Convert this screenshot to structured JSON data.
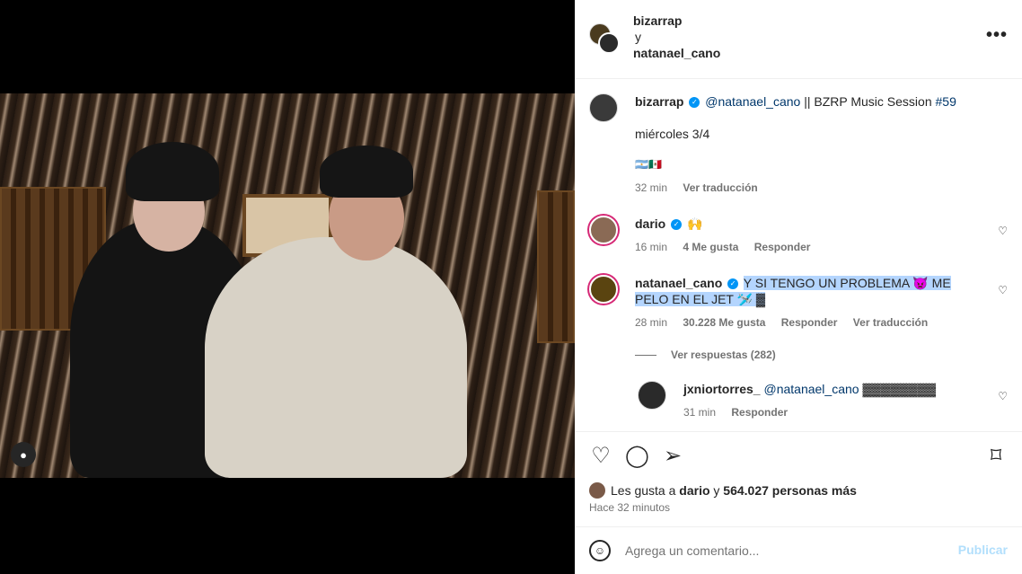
{
  "header": {
    "user1": "bizarrap",
    "joiner": "y",
    "user2": "natanael_cano",
    "more": "•••"
  },
  "caption": {
    "username": "bizarrap",
    "mention": "@natanael_cano",
    "text": " || BZRP Music Session ",
    "hashtag": "#59",
    "line2": "miércoles 3/4",
    "flags": "🇦🇷🇲🇽",
    "time": "32 min",
    "translate": "Ver traducción"
  },
  "comments": [
    {
      "username": "dario",
      "text": "🙌",
      "time": "16 min",
      "likes": "4 Me gusta",
      "reply": "Responder"
    },
    {
      "username": "natanael_cano",
      "text": "Y SI TENGO UN PROBLEMA 👿 ME PELO EN EL JET 🛩️ ▓",
      "time": "28 min",
      "likes": "30.228 Me gusta",
      "reply": "Responder",
      "translate": "Ver traducción",
      "view_replies": "Ver respuestas (282)"
    },
    {
      "username": "jxniortorres_",
      "mention": "@natanael_cano",
      "text": " ▓▓▓▓▓▓▓▓",
      "time": "31 min",
      "reply": "Responder"
    }
  ],
  "actions": {
    "likes_prefix": "Les gusta a ",
    "likes_user": "dario",
    "likes_mid": " y ",
    "likes_count": "564.027 personas más",
    "posted": "Hace 32 minutos"
  },
  "comment_box": {
    "placeholder": "Agrega un comentario...",
    "post": "Publicar"
  },
  "colors": {
    "link": "#00376b",
    "verified": "#0095f6",
    "highlight": "#b4d5fe"
  },
  "icons": [
    "heart-icon",
    "comment-icon",
    "share-icon",
    "bookmark-icon",
    "emoji-icon",
    "user-tag-icon",
    "more-icon",
    "verified-icon"
  ]
}
